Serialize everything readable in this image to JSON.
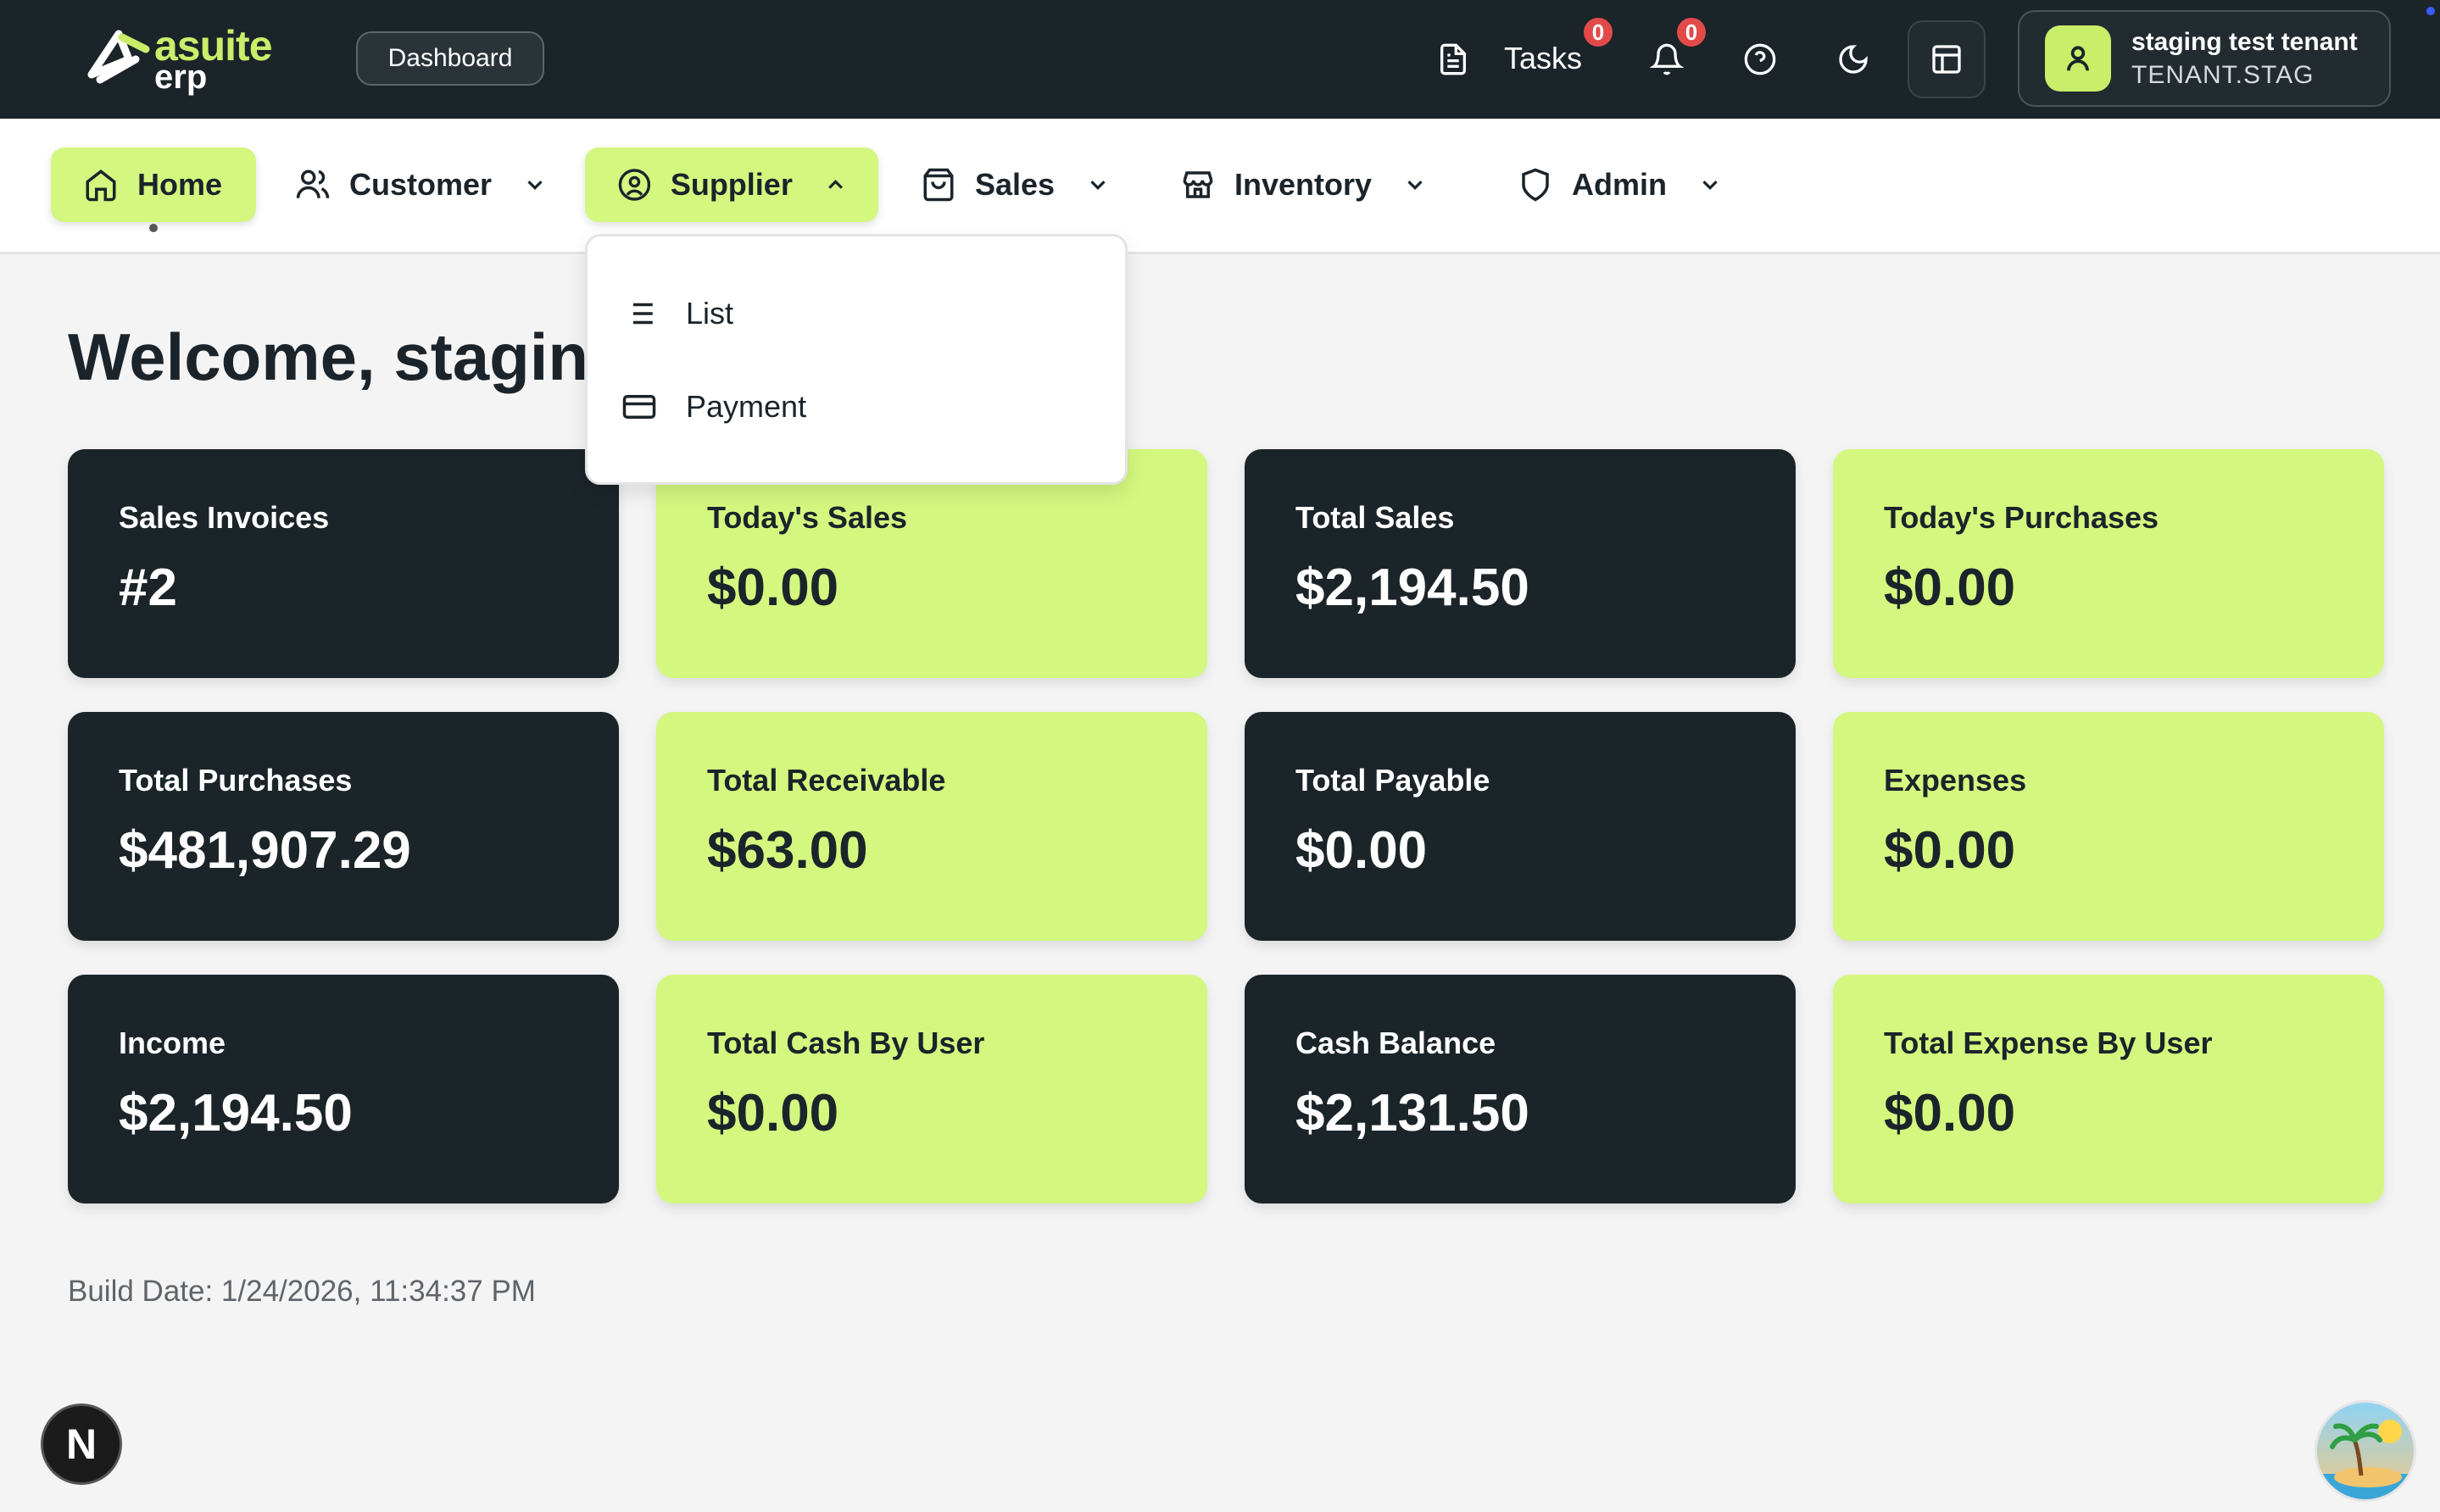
{
  "header": {
    "logo_top": "asuite",
    "logo_bottom": "erp",
    "dashboard_label": "Dashboard",
    "tasks_label": "Tasks",
    "tasks_badge": "0",
    "notifications_badge": "0",
    "tenant_name": "staging test tenant",
    "tenant_code": "TENANT.STAG"
  },
  "nav": {
    "home": "Home",
    "customer": "Customer",
    "supplier": "Supplier",
    "sales": "Sales",
    "inventory": "Inventory",
    "admin": "Admin"
  },
  "supplier_menu": {
    "items": [
      {
        "label": "List",
        "icon": "list-icon"
      },
      {
        "label": "Payment",
        "icon": "credit-card-icon"
      }
    ]
  },
  "main": {
    "welcome": "Welcome, staging test tenant",
    "cards": [
      {
        "label": "Sales Invoices",
        "value": "#2",
        "theme": "dark"
      },
      {
        "label": "Today's Sales",
        "value": "$0.00",
        "theme": "lime"
      },
      {
        "label": "Total Sales",
        "value": "$2,194.50",
        "theme": "dark"
      },
      {
        "label": "Today's Purchases",
        "value": "$0.00",
        "theme": "lime"
      },
      {
        "label": "Total Purchases",
        "value": "$481,907.29",
        "theme": "dark"
      },
      {
        "label": "Total Receivable",
        "value": "$63.00",
        "theme": "lime"
      },
      {
        "label": "Total Payable",
        "value": "$0.00",
        "theme": "dark"
      },
      {
        "label": "Expenses",
        "value": "$0.00",
        "theme": "lime"
      },
      {
        "label": "Income",
        "value": "$2,194.50",
        "theme": "dark"
      },
      {
        "label": "Total Cash By User",
        "value": "$0.00",
        "theme": "lime"
      },
      {
        "label": "Cash Balance",
        "value": "$2,131.50",
        "theme": "dark"
      },
      {
        "label": "Total Expense By User",
        "value": "$0.00",
        "theme": "lime"
      }
    ],
    "build_date": "Build Date: 1/24/2026, 11:34:37 PM"
  },
  "next_badge": "N",
  "colors": {
    "dark": "#1b2429",
    "lime": "#d4f77f",
    "accent": "#c8ee6a",
    "badge": "#e24a4a"
  }
}
